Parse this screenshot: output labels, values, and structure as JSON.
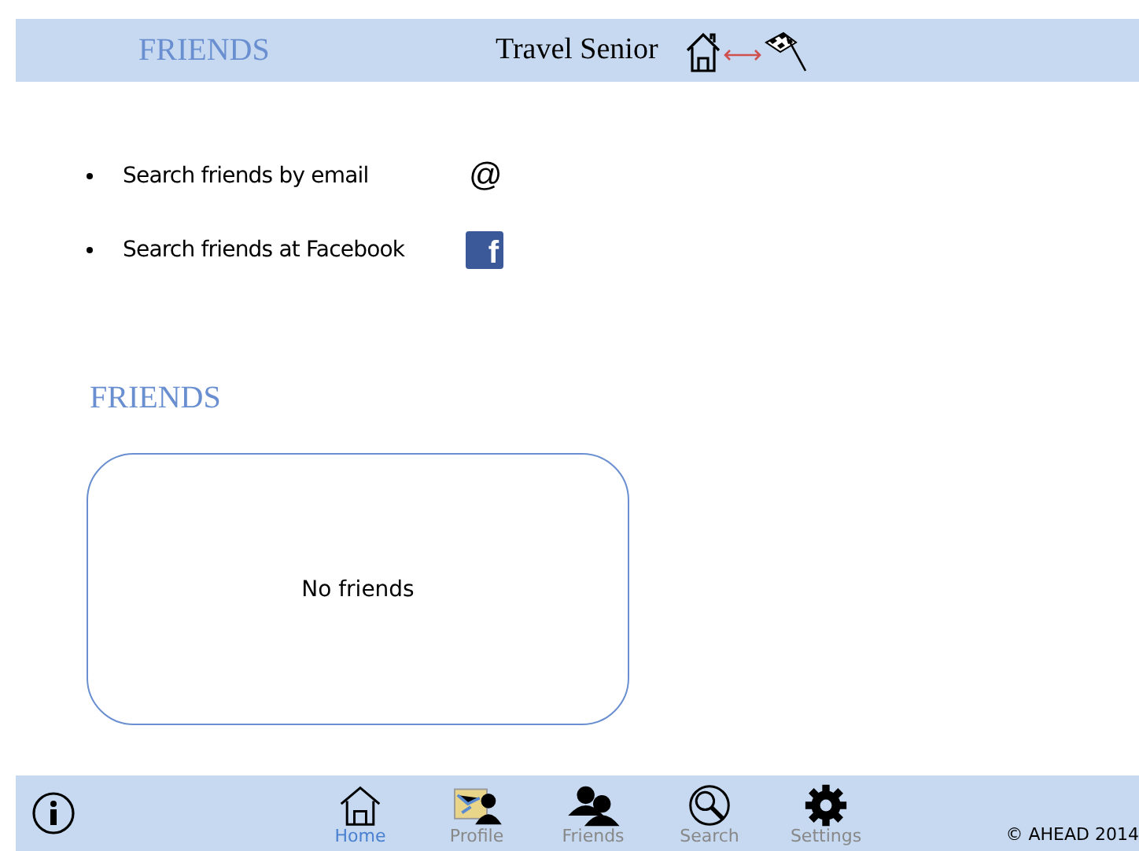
{
  "header": {
    "page_title": "FRIENDS",
    "app_title": "Travel Senior"
  },
  "search_options": [
    {
      "label": "Search friends by email",
      "kind": "email",
      "icon_text": "@"
    },
    {
      "label": "Search friends at Facebook",
      "kind": "facebook",
      "icon_text": "f"
    }
  ],
  "friends_section": {
    "title": "FRIENDS",
    "empty_message": "No friends"
  },
  "nav": [
    {
      "label": "Home",
      "kind": "home",
      "selected": true
    },
    {
      "label": "Profile",
      "kind": "profile",
      "selected": false
    },
    {
      "label": "Friends",
      "kind": "friends",
      "selected": false
    },
    {
      "label": "Search",
      "kind": "search",
      "selected": false
    },
    {
      "label": "Settings",
      "kind": "settings",
      "selected": false
    }
  ],
  "copyright": "© AHEAD 2014"
}
